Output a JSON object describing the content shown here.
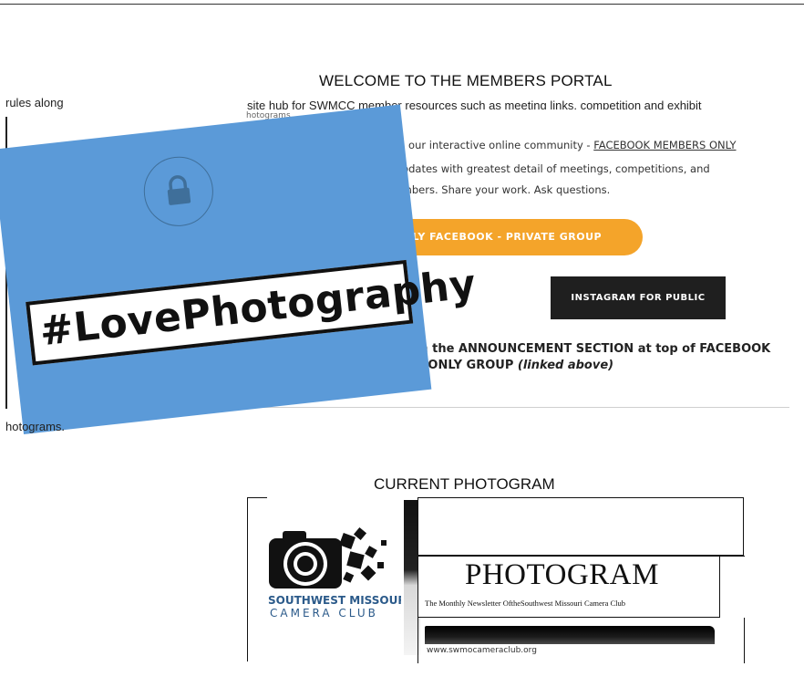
{
  "page": {
    "heading": "WELCOME TO THE MEMBERS PORTAL",
    "subtitle": "site hub for SWMCC member resources such as meeting links, competition and exhibit",
    "left_fragment_1": "rules along",
    "left_fragment_2": "hotograms."
  },
  "embedded_card": {
    "cut_text": "hotograms.",
    "line1": "o join our interactive online community - ",
    "line1_link": "FACEBOOK MEMBERS ONLY",
    "line2": "ute updates with greatest detail of meetings, competitions, and",
    "line3": "r members. Share your work. Ask questions.",
    "facebook_button": "ONLY FACEBOOK - PRIVATE GROUP",
    "instagram_button": "INSTAGRAM FOR PUBLIC",
    "announce_line1": "ities detailed in the ANNOUNCEMENT SECTION at top of FACEBOOK",
    "announce_line2": "MEMBERS' ONLY GROUP ",
    "announce_italic": "(linked above)",
    "accent_orange": "#f4a42a",
    "accent_dark": "#1f1f1f"
  },
  "graphic": {
    "hashtag": "#LovePhotography",
    "icon": "lock-icon",
    "background": "#5b9ad8"
  },
  "photogram": {
    "heading": "CURRENT PHOTOGRAM",
    "logo_line1": "SOUTHWEST MISSOURI",
    "logo_line2": "CAMERA CLUB",
    "title": "PHOTOGRAM",
    "subtitle": "The Monthly Newsletter OftheSouthwest Missouri Camerа Club",
    "url": "www.swmocameraclub.org"
  }
}
